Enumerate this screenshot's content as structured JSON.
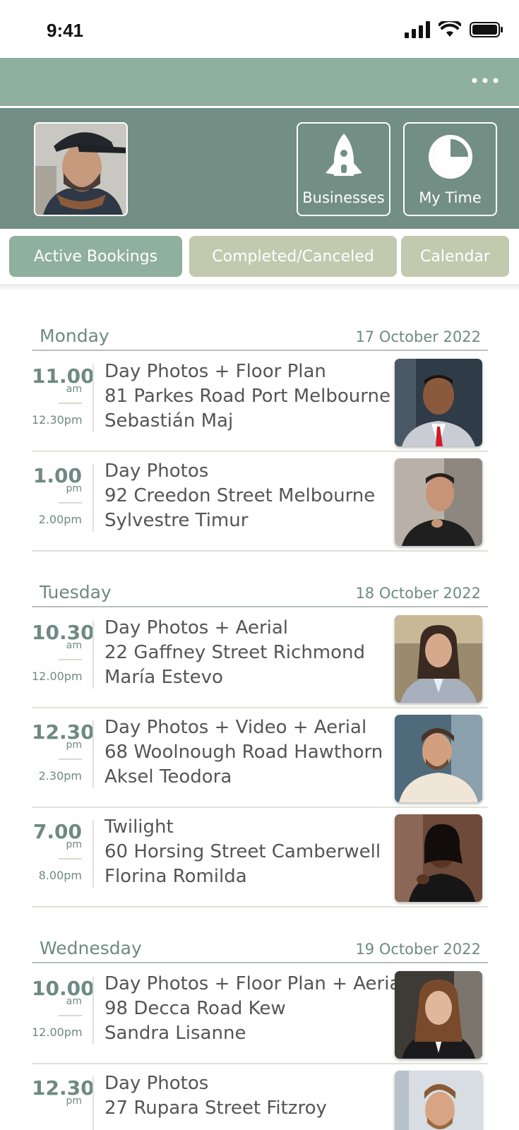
{
  "status": {
    "time": "9:41"
  },
  "header": {
    "tiles": [
      {
        "label": "Businesses",
        "icon": "rocket-icon"
      },
      {
        "label": "My Time",
        "icon": "clock-icon"
      }
    ]
  },
  "tabs": [
    {
      "label": "Active Bookings",
      "active": true
    },
    {
      "label": "Completed/Canceled",
      "active": false
    },
    {
      "label": "Calendar",
      "active": false
    }
  ],
  "days": [
    {
      "name": "Monday",
      "date": "17 October 2022",
      "bookings": [
        {
          "start": "11.00",
          "ampm": "am",
          "end": "12.30pm",
          "service": "Day Photos + Floor Plan",
          "address": "81  Parkes Road Port Melbourne",
          "client": "Sebastián Maj"
        },
        {
          "start": "1.00",
          "ampm": "pm",
          "end": "2.00pm",
          "service": "Day Photos",
          "address": "92  Creedon Street Melbourne",
          "client": "Sylvestre Timur"
        }
      ]
    },
    {
      "name": "Tuesday",
      "date": "18 October 2022",
      "bookings": [
        {
          "start": "10.30",
          "ampm": "am",
          "end": "12.00pm",
          "service": "Day Photos + Aerial",
          "address": "22  Gaffney Street Richmond",
          "client": "María Estevo"
        },
        {
          "start": "12.30",
          "ampm": "pm",
          "end": "2.30pm",
          "service": "Day Photos + Video + Aerial",
          "address": "68 Woolnough Road Hawthorn",
          "client": "Aksel Teodora"
        },
        {
          "start": "7.00",
          "ampm": "pm",
          "end": "8.00pm",
          "service": "Twilight",
          "address": "60 Horsing Street Camberwell",
          "client": "Florina Romilda"
        }
      ]
    },
    {
      "name": "Wednesday",
      "date": "19 October 2022",
      "bookings": [
        {
          "start": "10.00",
          "ampm": "am",
          "end": "12.00pm",
          "service": "Day Photos + Floor Plan + Aerial",
          "address": "98 Decca Road Kew",
          "client": "Sandra Lisanne"
        },
        {
          "start": "12.30",
          "ampm": "pm",
          "end": "",
          "service": "Day Photos",
          "address": "27 Rupara Street Fitzroy",
          "client": ""
        }
      ]
    }
  ]
}
